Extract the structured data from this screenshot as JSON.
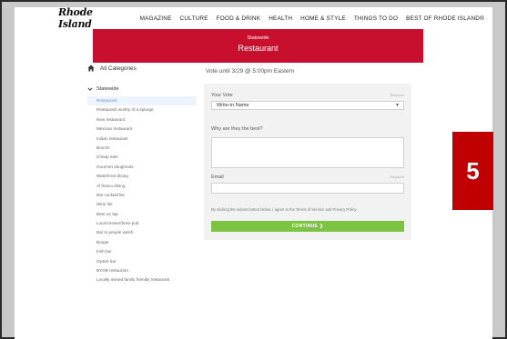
{
  "nav": {
    "logo": "Rhode Island",
    "items": [
      "MAGAZINE",
      "CULTURE",
      "FOOD & DRINK",
      "HEALTH",
      "HOME & STYLE",
      "THINGS TO DO",
      "BEST OF RHODE ISLAND®"
    ]
  },
  "hero": {
    "subtitle": "Statewide",
    "title": "Restaurant",
    "color": "#c8102e"
  },
  "sidebar": {
    "all_categories": "All Categories",
    "group": "Statewide",
    "categories": [
      "Restaurant",
      "Restaurant worthy of a splurge",
      "New restaurant",
      "Mexican restaurant",
      "Indian restaurant",
      "Brunch",
      "Cheap eats",
      "Gourmet doughnuts",
      "Waterfront dining",
      "Al fresco dining",
      "Bar cocktail list",
      "Wine list",
      "Beer on tap",
      "Local brewer/brew pub",
      "Bar to people watch",
      "Burger",
      "Irish bar",
      "Oyster bar",
      "BYOB restaurant",
      "Locally owned family friendly restaurant"
    ]
  },
  "main": {
    "vote_until": "Vote until 3/29 @ 5:00pm Eastern"
  },
  "form": {
    "your_vote_label": "Your Vote",
    "required": "Required",
    "select_value": "Write-in Name",
    "why_label": "Why are they the best?",
    "email_label": "Email",
    "terms": "By clicking the submit button below, I agree to the Terms of Service and Privacy Policy",
    "continue": "CONTINUE ❯",
    "continue_color": "#7cc243"
  },
  "badge": {
    "number": "5",
    "color": "#c00000"
  }
}
